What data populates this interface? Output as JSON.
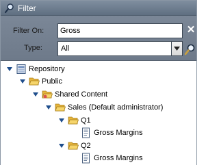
{
  "window": {
    "title": "Filter"
  },
  "filter": {
    "filter_on_label": "Filter On:",
    "filter_on_value": "Gross",
    "type_label": "Type:",
    "type_value": "All"
  },
  "tree": {
    "nodes": [
      {
        "label": "Repository",
        "icon": "repository-icon",
        "expanded": true
      },
      {
        "label": "Public",
        "icon": "folder-icon",
        "expanded": true
      },
      {
        "label": "Shared Content",
        "icon": "folder-icon",
        "expanded": true
      },
      {
        "label": "Sales (Default administrator)",
        "icon": "folder-icon",
        "expanded": true
      },
      {
        "label": "Q1",
        "icon": "folder-icon",
        "expanded": true
      },
      {
        "label": "Gross Margins",
        "icon": "report-icon"
      },
      {
        "label": "Q2",
        "icon": "folder-icon",
        "expanded": true
      },
      {
        "label": "Gross Margins",
        "icon": "report-icon"
      }
    ]
  },
  "colors": {
    "header": "#6e7a8a",
    "folder": "#f2c94c",
    "accent": "#1f4e8c"
  }
}
